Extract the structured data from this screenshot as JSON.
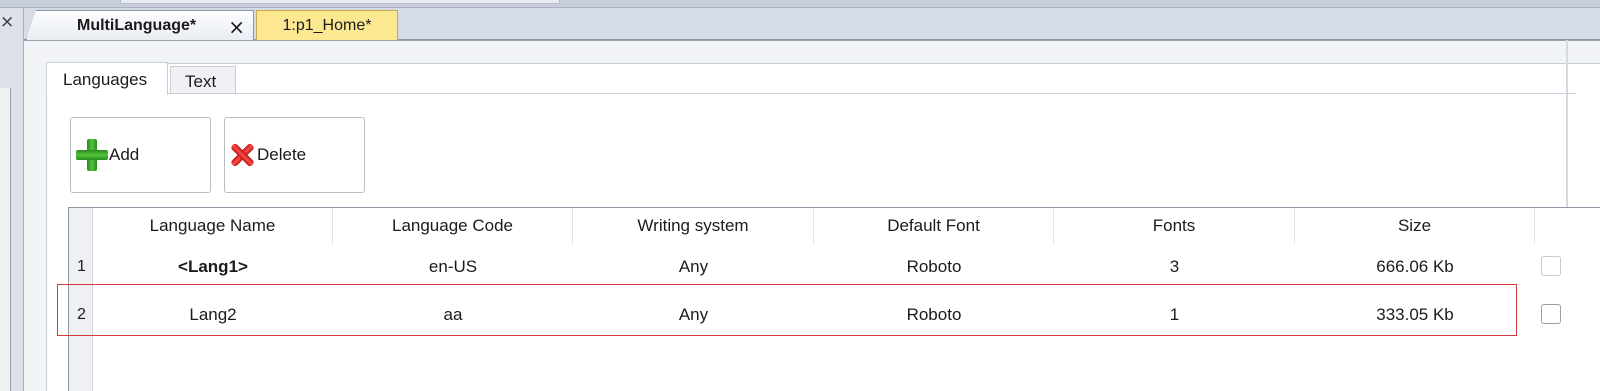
{
  "window": {
    "left_pane_close": "×"
  },
  "doc_tabs": [
    {
      "label": "MultiLanguage*",
      "active": true,
      "close": "×"
    },
    {
      "label": "1:p1_Home*",
      "active": false
    }
  ],
  "sub_tabs": [
    {
      "label": "Languages",
      "active": true
    },
    {
      "label": "Text",
      "active": false
    }
  ],
  "toolbar": {
    "add_label": "Add",
    "delete_label": "Delete"
  },
  "table": {
    "columns": [
      "Language Name",
      "Language Code",
      "Writing system",
      "Default Font",
      "Fonts",
      "Size"
    ],
    "rows": [
      {
        "num": "1",
        "name": "<Lang1>",
        "code": "en-US",
        "writing": "Any",
        "font": "Roboto",
        "fonts": "3",
        "size": "666.06 Kb",
        "default": true
      },
      {
        "num": "2",
        "name": "Lang2",
        "code": "aa",
        "writing": "Any",
        "font": "Roboto",
        "fonts": "1",
        "size": "333.05 Kb",
        "default": false
      }
    ]
  },
  "colors": {
    "selection_outline": "#d23a3a",
    "tab_yellow": "#fbe890",
    "add_icon": "#3aa82a",
    "delete_icon": "#e02828"
  }
}
